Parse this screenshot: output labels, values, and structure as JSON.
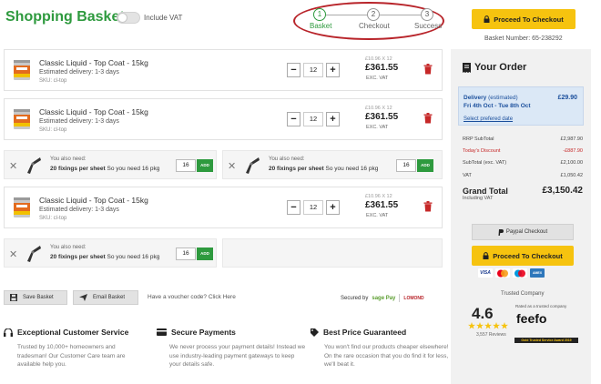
{
  "header": {
    "title": "Shopping Basket",
    "include_vat_label": "Include VAT",
    "steps": [
      {
        "number": "1",
        "label": "Basket"
      },
      {
        "number": "2",
        "label": "Checkout"
      },
      {
        "number": "3",
        "label": "Success"
      }
    ],
    "checkout_label": "Proceed To Checkout",
    "basket_number": "Basket Number: 65-238292"
  },
  "items": [
    {
      "name": "Classic Liquid - Top Coat - 15kg",
      "delivery": "Estimated delivery: 1-3 days",
      "sku": "SKU: cl-top",
      "qty": "12",
      "unit_price": "£10.96 X 12",
      "total": "£361.55",
      "vat_note": "EXC. VAT"
    },
    {
      "name": "Classic Liquid - Top Coat - 15kg",
      "delivery": "Estimated delivery: 1-3 days",
      "sku": "SKU: cl-top",
      "qty": "12",
      "unit_price": "£10.96 X 12",
      "total": "£361.55",
      "vat_note": "EXC. VAT"
    },
    {
      "name": "Classic Liquid - Top Coat - 15kg",
      "delivery": "Estimated delivery: 1-3 days",
      "sku": "SKU: cl-top",
      "qty": "12",
      "unit_price": "£10.96 X 12",
      "total": "£361.55",
      "vat_note": "EXC. VAT"
    }
  ],
  "addons": [
    {
      "need": "You also need:",
      "desc_bold": "20 fixings per sheet",
      "desc_rest": " So you need 16 pkg",
      "qty": "16",
      "add_label": "ADD"
    },
    {
      "need": "You also need:",
      "desc_bold": "20 fixings per sheet",
      "desc_rest": " So you need 16 pkg",
      "qty": "16",
      "add_label": "ADD"
    },
    {
      "need": "You also need:",
      "desc_bold": "20 fixings per sheet",
      "desc_rest": " So you need 16 pkg",
      "qty": "16",
      "add_label": "ADD"
    }
  ],
  "actions": {
    "save_label": "Save Basket",
    "email_label": "Email Basket",
    "voucher_text": "Have a voucher code? Click Here",
    "secured_by": "Secured by",
    "sagepay": "sage Pay",
    "lomond": "LOMOND"
  },
  "order": {
    "title": "Your Order",
    "delivery_label": "Delivery",
    "delivery_estimated": " (estimated)",
    "delivery_price": "£29.90",
    "delivery_dates": "Fri 4th Oct - Tue 8th Oct",
    "delivery_link": "Select prefered date",
    "rrp_label": "RRP SubTotal",
    "rrp_value": "£2,987.90",
    "discount_label": "Today's Discount",
    "discount_value": "-£887.90",
    "subtotal_label": "SubTotal (exc. VAT)",
    "subtotal_value": "£2,100.00",
    "vat_label": "VAT",
    "vat_value": "£1,050.42",
    "grand_label": "Grand Total",
    "grand_sub": "Including VAT",
    "grand_value": "£3,150.42",
    "paypal_label": "Paypal Checkout",
    "checkout_label": "Proceed To Checkout",
    "cards": [
      "VISA",
      "MC",
      "MAESTRO",
      "AMEX"
    ],
    "trusted": "Trusted Company",
    "rating": "4.6",
    "reviews": "3,557 Reviews",
    "rated_text": "Rated as a trusted company",
    "feefo_logo": "feefo",
    "feefo_award": "Gold Trusted Service Award 2019",
    "colors": {
      "accent_green": "#2e9a3e",
      "cta_yellow": "#f6c30f",
      "discount_red": "#c62828",
      "delivery_blue": "#1b4f9c"
    }
  },
  "features": [
    {
      "title": "Exceptional Customer Service",
      "text": "Trusted by 10,000+ homeowners and tradesman! Our Customer Care team are available help you."
    },
    {
      "title": "Secure Payments",
      "text": "We never process your payment details! Instead we use industry-leading payment gateways to keep your details safe."
    },
    {
      "title": "Best Price Guaranteed",
      "text": "You won't find our products cheaper elsewhere! On the rare occasion that you do find it for less, we'll beat it."
    }
  ]
}
